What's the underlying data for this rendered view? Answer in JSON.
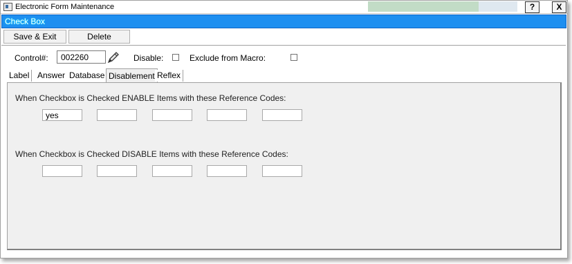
{
  "window": {
    "title": "Electronic Form Maintenance",
    "help_label": "?",
    "close_label": "X"
  },
  "header": {
    "title": "Check Box"
  },
  "toolbar": {
    "save_exit_label": "Save & Exit",
    "delete_label": "Delete"
  },
  "control": {
    "label": "Control#:",
    "value": "002260",
    "disable_label": "Disable:",
    "exclude_label": "Exclude from Macro:"
  },
  "tabs": [
    {
      "label": "Label"
    },
    {
      "label": "Answer"
    },
    {
      "label": "Database"
    },
    {
      "label": "Disablement"
    },
    {
      "label": "Reflex"
    }
  ],
  "disablement": {
    "enable_heading": "When Checkbox is Checked ENABLE Items with these Reference Codes:",
    "enable_codes": [
      "yes",
      "",
      "",
      "",
      ""
    ],
    "disable_heading": "When Checkbox is Checked DISABLE Items with these Reference Codes:",
    "disable_codes": [
      "",
      "",
      "",
      "",
      ""
    ]
  }
}
